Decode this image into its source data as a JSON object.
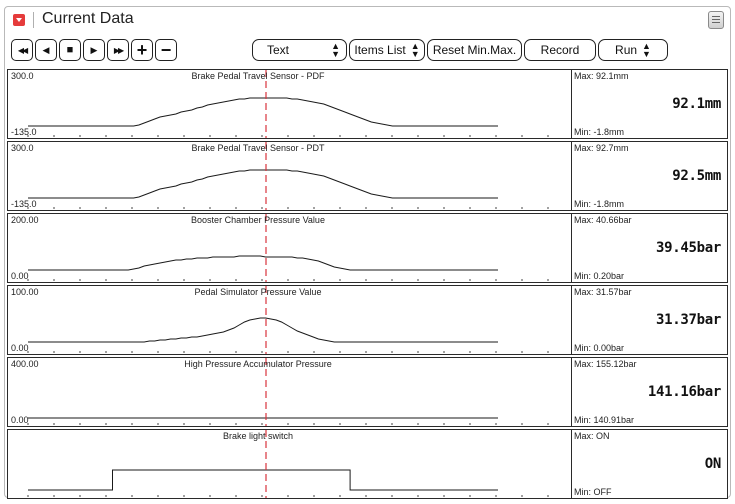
{
  "window": {
    "title": "Current Data"
  },
  "toolbar": {
    "rewind_glyph": "◀◀",
    "prev_glyph": "◀",
    "stop_glyph": "■",
    "play_glyph": "▶",
    "forward_glyph": "▶▶",
    "zoom_in_glyph": "+",
    "zoom_out_glyph": "−",
    "view_mode_value": "Text",
    "view_mode_options": [
      "Text"
    ],
    "items_list_label": "Items List",
    "reset_label": "Reset Min.Max.",
    "record_label": "Record",
    "run_label": "Run"
  },
  "colors": {
    "cursor": "#d9343d",
    "trace": "#1a1a1a"
  },
  "sensors": [
    {
      "name": "Brake Pedal Travel Sensor - PDF",
      "y_max": "300.0",
      "y_min": "-135.0",
      "max": "Max:  92.1mm",
      "min": "Min:  -1.8mm",
      "current": "92.1mm",
      "trace": [
        0,
        0,
        0,
        0,
        0,
        0,
        0,
        0,
        0,
        0,
        0,
        0,
        0,
        0,
        0,
        0,
        0,
        0,
        0,
        0,
        0,
        1,
        3,
        5,
        7,
        9,
        10,
        11,
        12,
        14,
        15,
        16,
        18,
        19,
        21,
        22,
        23,
        24,
        25,
        26,
        27,
        27,
        28,
        28,
        28,
        28,
        28,
        28,
        28,
        28,
        27,
        27,
        26,
        25,
        24,
        23,
        22,
        20,
        18,
        16,
        14,
        12,
        10,
        8,
        6,
        4,
        3,
        2,
        1,
        0,
        0,
        0,
        0,
        0,
        0,
        0,
        0,
        0,
        0,
        0,
        0,
        0,
        0,
        0,
        0,
        0,
        0,
        0,
        0,
        0
      ]
    },
    {
      "name": "Brake Pedal Travel Sensor - PDT",
      "y_max": "300.0",
      "y_min": "-135.0",
      "max": "Max:  92.7mm",
      "min": "Min:  -1.8mm",
      "current": "92.5mm",
      "trace": [
        0,
        0,
        0,
        0,
        0,
        0,
        0,
        0,
        0,
        0,
        0,
        0,
        0,
        0,
        0,
        0,
        0,
        0,
        0,
        0,
        0,
        1,
        3,
        5,
        7,
        9,
        10,
        11,
        12,
        14,
        15,
        16,
        18,
        19,
        21,
        22,
        23,
        24,
        25,
        26,
        27,
        27,
        28,
        28,
        28,
        28,
        28,
        28,
        28,
        28,
        27,
        27,
        26,
        25,
        24,
        23,
        22,
        20,
        18,
        16,
        14,
        12,
        10,
        8,
        6,
        4,
        3,
        2,
        1,
        0,
        0,
        0,
        0,
        0,
        0,
        0,
        0,
        0,
        0,
        0,
        0,
        0,
        0,
        0,
        0,
        0,
        0,
        0,
        0,
        0
      ]
    },
    {
      "name": "Booster Chamber Pressure Value",
      "y_max": "200.00",
      "y_min": "0.00",
      "max": "Max:  40.66bar",
      "min": "Min:  0.20bar",
      "current": "39.45bar",
      "trace": [
        0,
        0,
        0,
        0,
        0,
        0,
        0,
        0,
        0,
        0,
        0,
        0,
        0,
        0,
        0,
        0,
        0,
        0,
        0,
        0,
        1,
        2,
        4,
        5,
        6,
        7,
        8,
        9,
        10,
        10,
        11,
        11,
        12,
        12,
        12,
        13,
        13,
        13,
        13,
        13,
        14,
        14,
        14,
        14,
        14,
        13,
        13,
        13,
        13,
        13,
        13,
        12,
        12,
        11,
        10,
        9,
        7,
        5,
        3,
        2,
        1,
        0,
        0,
        0,
        0,
        0,
        0,
        0,
        0,
        0,
        0,
        0,
        0,
        0,
        0,
        0,
        0,
        0,
        0,
        0,
        0,
        0,
        0,
        0,
        0,
        0,
        0,
        0,
        0,
        0
      ]
    },
    {
      "name": "Pedal Simulator Pressure Value",
      "y_max": "100.00",
      "y_min": "0.00",
      "max": "Max:  31.57bar",
      "min": "Min:  0.00bar",
      "current": "31.37bar",
      "trace": [
        0,
        0,
        0,
        0,
        0,
        0,
        0,
        0,
        0,
        0,
        0,
        0,
        0,
        0,
        0,
        0,
        0,
        0,
        0,
        0,
        0,
        0,
        0,
        1,
        1,
        2,
        2,
        3,
        3,
        4,
        4,
        5,
        5,
        6,
        7,
        8,
        9,
        10,
        12,
        14,
        17,
        20,
        22,
        23,
        24,
        24,
        23,
        22,
        20,
        17,
        14,
        11,
        9,
        7,
        5,
        3,
        2,
        1,
        0,
        0,
        0,
        0,
        0,
        0,
        0,
        0,
        0,
        0,
        0,
        0,
        0,
        0,
        0,
        0,
        0,
        0,
        0,
        0,
        0,
        0,
        0,
        0,
        0,
        0,
        0,
        0,
        0,
        0,
        0,
        0
      ]
    },
    {
      "name": "High Pressure Accumulator Pressure",
      "y_max": "400.00",
      "y_min": "0.00",
      "max": "Max:  155.12bar",
      "min": "Min:  140.91bar",
      "current": "141.16bar",
      "trace": [
        0,
        0,
        0,
        0,
        0,
        0,
        0,
        0,
        0,
        0,
        0,
        0,
        0,
        0,
        0,
        0,
        0,
        0,
        0,
        0,
        0,
        0,
        0,
        0,
        0,
        0,
        0,
        0,
        0,
        0,
        0,
        0,
        0,
        0,
        0,
        0,
        0,
        0,
        0,
        0,
        0,
        0,
        0,
        0,
        0,
        0,
        0,
        0,
        0,
        0,
        0,
        0,
        0,
        0,
        0,
        0,
        0,
        0,
        0,
        0,
        0,
        0,
        0,
        0,
        0,
        0,
        0,
        0,
        0,
        0,
        0,
        0,
        0,
        0,
        0,
        0,
        0,
        0,
        0,
        0,
        0,
        0,
        0,
        0,
        0,
        0,
        0,
        0,
        0,
        0
      ]
    },
    {
      "name": "Brake light switch",
      "y_max": "",
      "y_min": "",
      "max": "Max:  ON",
      "min": "Min:  OFF",
      "current": "ON",
      "trace": [
        0,
        0,
        0,
        0,
        0,
        0,
        0,
        0,
        0,
        0,
        0,
        0,
        0,
        0,
        0,
        0,
        1,
        1,
        1,
        1,
        1,
        1,
        1,
        1,
        1,
        1,
        1,
        1,
        1,
        1,
        1,
        1,
        1,
        1,
        1,
        1,
        1,
        1,
        1,
        1,
        1,
        1,
        1,
        1,
        1,
        1,
        1,
        1,
        1,
        1,
        1,
        1,
        1,
        1,
        1,
        1,
        1,
        1,
        1,
        1,
        1,
        0,
        0,
        0,
        0,
        0,
        0,
        0,
        0,
        0,
        0,
        0,
        0,
        0,
        0,
        0,
        0,
        0,
        0,
        0,
        0,
        0,
        0,
        0,
        0,
        0,
        0,
        0,
        0,
        0
      ]
    }
  ]
}
